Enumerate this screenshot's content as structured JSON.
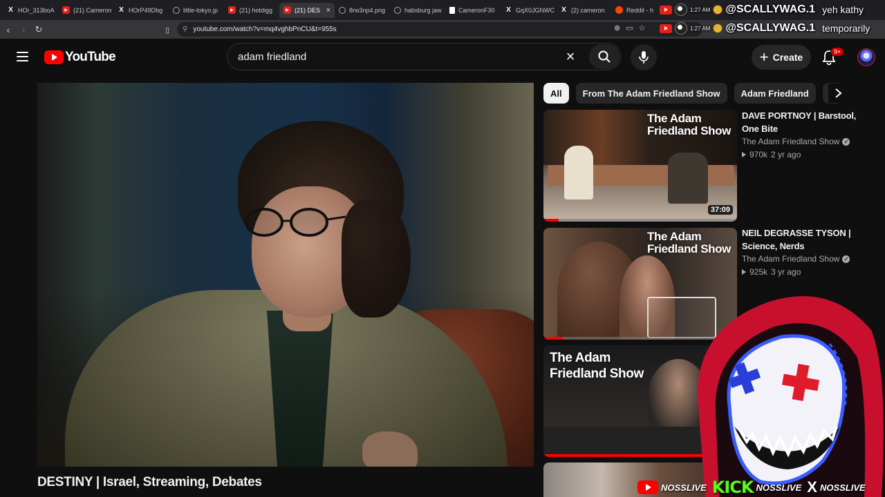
{
  "browser": {
    "tabs": [
      {
        "title": "HOr_313boA",
        "icon": "x"
      },
      {
        "title": "(21) Cameron",
        "icon": "yt"
      },
      {
        "title": "HOrP49Dbg",
        "icon": "x"
      },
      {
        "title": "little-tokyo.jp",
        "icon": "globe"
      },
      {
        "title": "(21) hotdigg",
        "icon": "yt"
      },
      {
        "title": "(21) DES",
        "icon": "yt",
        "active": true
      },
      {
        "title": "8rw3np4.png",
        "icon": "globe"
      },
      {
        "title": "habsburg jaw",
        "icon": "img"
      },
      {
        "title": "CameronF30",
        "icon": "doc"
      },
      {
        "title": "GqX0JGNWC",
        "icon": "x"
      },
      {
        "title": "(2) cameron",
        "icon": "x"
      },
      {
        "title": "Reddit - h",
        "icon": "reddit"
      }
    ],
    "url": "youtube.com/watch?v=mq4vghbPnCU&t=955s"
  },
  "overlay_chat": [
    {
      "time": "1:27 AM",
      "user": "@SCALLYWAG.1",
      "message": "yeh kathy"
    },
    {
      "time": "1:27 AM",
      "user": "@SCALLYWAG.1",
      "message": "temporarily"
    }
  ],
  "youtube": {
    "logo_text": "YouTube",
    "search_query": "adam friedland",
    "create_label": "Create",
    "notification_count": "9+",
    "video_title": "DESTINY | Israel, Streaming, Debates",
    "chips": [
      "All",
      "From The Adam Friedland Show",
      "Adam Friedland",
      "Pol"
    ],
    "recommendations": [
      {
        "title": "DAVE PORTNOY | Barstool, One Bite",
        "channel": "The Adam Friedland Show",
        "views": "970k",
        "age": "2 yr ago",
        "duration": "37:09",
        "thumb_text": "The Adam Friedland Show",
        "watched": 0.08
      },
      {
        "title": "NEIL DEGRASSE TYSON | Science, Nerds",
        "channel": "The Adam Friedland Show",
        "views": "925k",
        "age": "3 yr ago",
        "thumb_text": "The Adam Friedland Show",
        "watched": 0.1
      },
      {
        "title": "",
        "channel": "",
        "thumb_text": "The Adam Friedland Show",
        "watched": 0.85
      }
    ]
  },
  "stream_overlay": {
    "socials": [
      "NOSSLIVE",
      "KICK",
      "NOSSLIVE",
      "NOSSLIVE"
    ]
  },
  "colors": {
    "yt_red": "#ff0000",
    "kick_green": "#53fc18",
    "background": "#0f0f0f"
  }
}
